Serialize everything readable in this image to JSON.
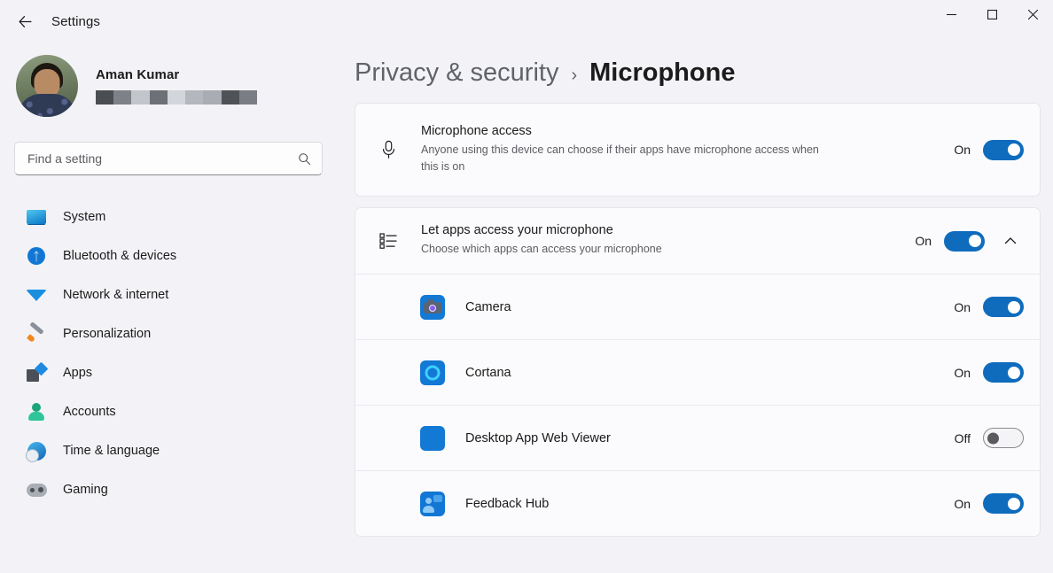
{
  "window": {
    "app_title": "Settings",
    "back_icon": "back-arrow-icon",
    "minimize_label": "—",
    "maximize_label": "□",
    "close_label": "✕"
  },
  "account": {
    "name": "Aman Kumar",
    "email_redacted": true,
    "email_blocks": [
      "#4a4d52",
      "#7e8187",
      "#c2c5ca",
      "#6d7076",
      "#d2d5da",
      "#b4b7bd",
      "#a9acb2",
      "#4f5257",
      "#7a7d83"
    ]
  },
  "search": {
    "placeholder": "Find a setting",
    "value": "",
    "icon": "search-icon"
  },
  "sidebar": {
    "items": [
      {
        "label": "System",
        "icon": "system-icon"
      },
      {
        "label": "Bluetooth & devices",
        "icon": "bluetooth-icon"
      },
      {
        "label": "Network & internet",
        "icon": "network-icon"
      },
      {
        "label": "Personalization",
        "icon": "personalization-icon"
      },
      {
        "label": "Apps",
        "icon": "apps-icon"
      },
      {
        "label": "Accounts",
        "icon": "accounts-icon"
      },
      {
        "label": "Time & language",
        "icon": "time-language-icon"
      },
      {
        "label": "Gaming",
        "icon": "gaming-icon"
      }
    ]
  },
  "breadcrumb": {
    "parent": "Privacy & security",
    "separator": "›",
    "current": "Microphone"
  },
  "settings": {
    "microphone_access": {
      "title": "Microphone access",
      "description": "Anyone using this device can choose if their apps have microphone access when this is on",
      "state": "On",
      "icon": "microphone-icon"
    },
    "let_apps_access": {
      "title": "Let apps access your microphone",
      "description": "Choose which apps can access your microphone",
      "state": "On",
      "icon": "app-list-icon",
      "expanded": true,
      "chevron": "chevron-up-icon"
    },
    "apps": [
      {
        "name": "Camera",
        "state": "On",
        "icon": "camera-app-icon"
      },
      {
        "name": "Cortana",
        "state": "On",
        "icon": "cortana-app-icon"
      },
      {
        "name": "Desktop App Web Viewer",
        "state": "Off",
        "icon": "desktop-app-web-viewer-icon"
      },
      {
        "name": "Feedback Hub",
        "state": "On",
        "icon": "feedback-hub-app-icon"
      }
    ]
  },
  "colors": {
    "accent": "#0f6cbd",
    "page_bg": "#f3f3f7",
    "card_bg": "#fbfbfd"
  }
}
